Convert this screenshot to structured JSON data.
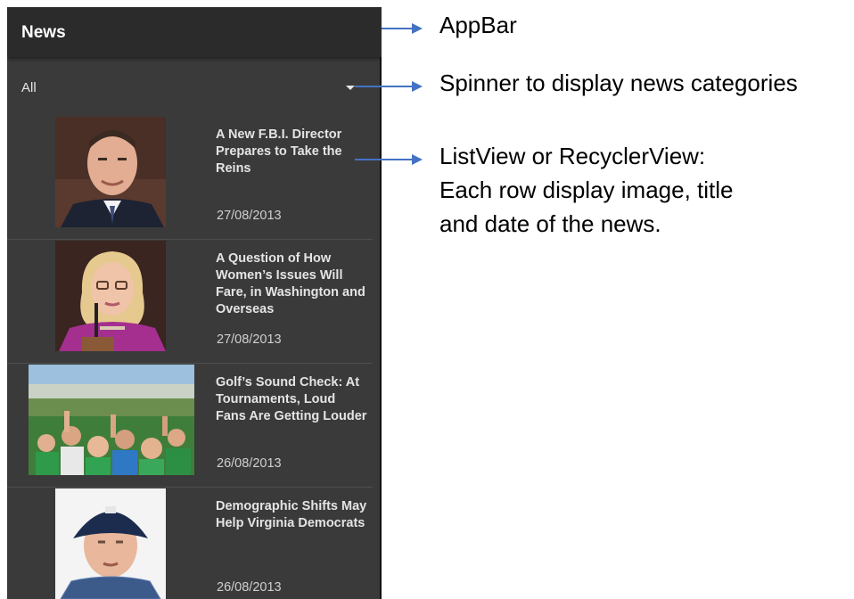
{
  "app": {
    "title": "News",
    "category_spinner": {
      "selected": "All"
    }
  },
  "news": [
    {
      "title": "A New F.B.I. Director Prepares to Take the Reins",
      "date": "27/08/2013"
    },
    {
      "title": "A Question of How Women’s Issues Will Fare, in Washington and Overseas",
      "date": "27/08/2013"
    },
    {
      "title": "Golf’s Sound Check: At Tournaments, Loud Fans Are Getting Louder",
      "date": "26/08/2013"
    },
    {
      "title": "Demographic Shifts May Help Virginia Democrats",
      "date": "26/08/2013"
    }
  ],
  "annotations": {
    "appbar": "AppBar",
    "spinner": "Spinner to display news categories",
    "list": [
      "ListView or RecyclerView:",
      "Each row display image, title",
      "and date of the news."
    ]
  },
  "colors": {
    "arrow": "#4472c4",
    "phone_bg": "#3a3a3a",
    "appbar_bg": "#2b2b2b"
  }
}
